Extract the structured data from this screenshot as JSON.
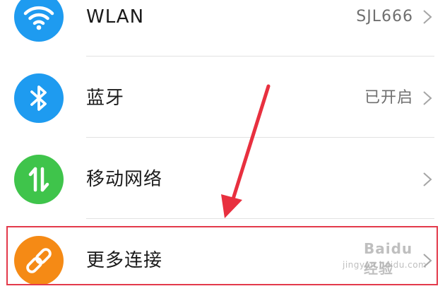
{
  "settings": {
    "rows": [
      {
        "label": "WLAN",
        "value": "SJL666",
        "icon": "wifi-icon",
        "icon_color": "#1e9bf0"
      },
      {
        "label": "蓝牙",
        "value": "已开启",
        "icon": "bluetooth-icon",
        "icon_color": "#1e9bf0"
      },
      {
        "label": "移动网络",
        "value": "",
        "icon": "mobile-data-icon",
        "icon_color": "#3fc44b"
      },
      {
        "label": "更多连接",
        "value": "",
        "icon": "link-icon",
        "icon_color": "#f58a15"
      }
    ]
  },
  "annotation": {
    "arrow_color": "#e8303f",
    "highlight_color": "#e33a4b"
  },
  "watermark": {
    "logo": "Baidu经验",
    "url": "jingyan.baidu.com"
  }
}
